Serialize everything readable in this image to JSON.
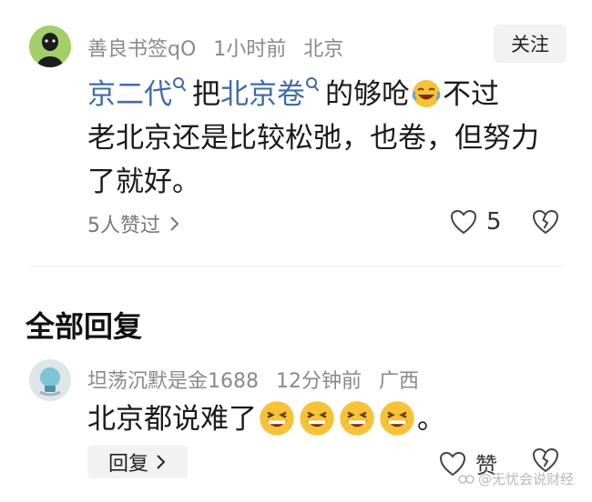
{
  "comment": {
    "username": "善良书签qO",
    "time": "1小时前",
    "location": "北京",
    "follow_label": "关注",
    "text_parts": {
      "link1": "京二代",
      "t1": "把",
      "link2": "北京卷",
      "t2": "的够呛",
      "t3": "不过",
      "line2": "老北京还是比较松弛，也卷，但努力",
      "line3": "了就好。"
    },
    "liked_by": "5人赞过",
    "like_count": "5"
  },
  "section_title": "全部回复",
  "reply": {
    "username": "坦荡沉默是金1688",
    "time": "12分钟前",
    "location": "广西",
    "text": "北京都说难了",
    "text_end": "。",
    "laugh_count": 4,
    "reply_label": "回复",
    "like_label": "赞"
  },
  "watermark": "@无忧会说财经",
  "icons": [
    "search-icon",
    "laugh-emoji-icon",
    "heart-icon",
    "broken-heart-icon",
    "chevron-right-icon"
  ]
}
